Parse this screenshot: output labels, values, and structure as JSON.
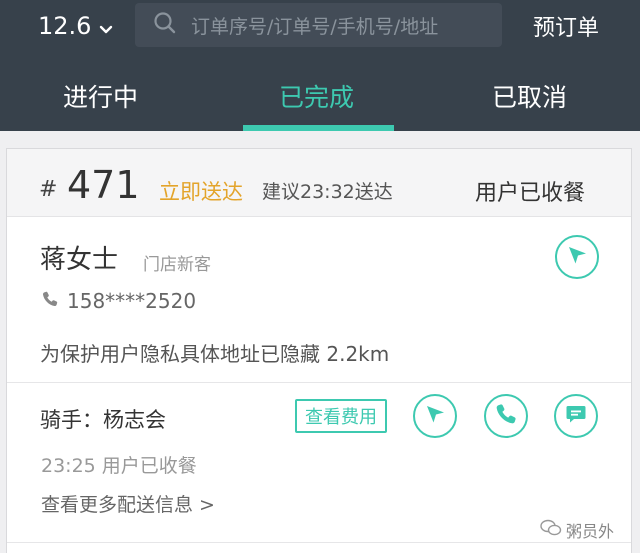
{
  "header": {
    "date": "12.6",
    "search_placeholder": "订单序号/订单号/手机号/地址",
    "reserve_label": "预订单"
  },
  "tabs": [
    {
      "label": "进行中",
      "active": false
    },
    {
      "label": "已完成",
      "active": true
    },
    {
      "label": "已取消",
      "active": false
    }
  ],
  "order": {
    "hash": "#",
    "number": "471",
    "delivery_type": "立即送达",
    "suggest_time": "建议23:32送达",
    "status": "用户已收餐",
    "customer": {
      "name": "蒋女士",
      "tag": "门店新客",
      "phone": "158****2520",
      "address": "为保护用户隐私具体地址已隐藏   2.2km"
    },
    "rider": {
      "label": "骑手：杨志会",
      "fee_button": "查看费用",
      "status": "23:25  用户已收餐",
      "more_info": "查看更多配送信息 >"
    }
  },
  "watermark": "粥员外",
  "colors": {
    "header_bg": "#37414b",
    "accent": "#3dc9b0",
    "orange": "#e3a42b"
  },
  "icons": {
    "search": "search-icon",
    "navigate": "navigation-arrow-icon",
    "phone": "phone-icon",
    "message": "message-icon",
    "chevron": "chevron-down-icon"
  }
}
